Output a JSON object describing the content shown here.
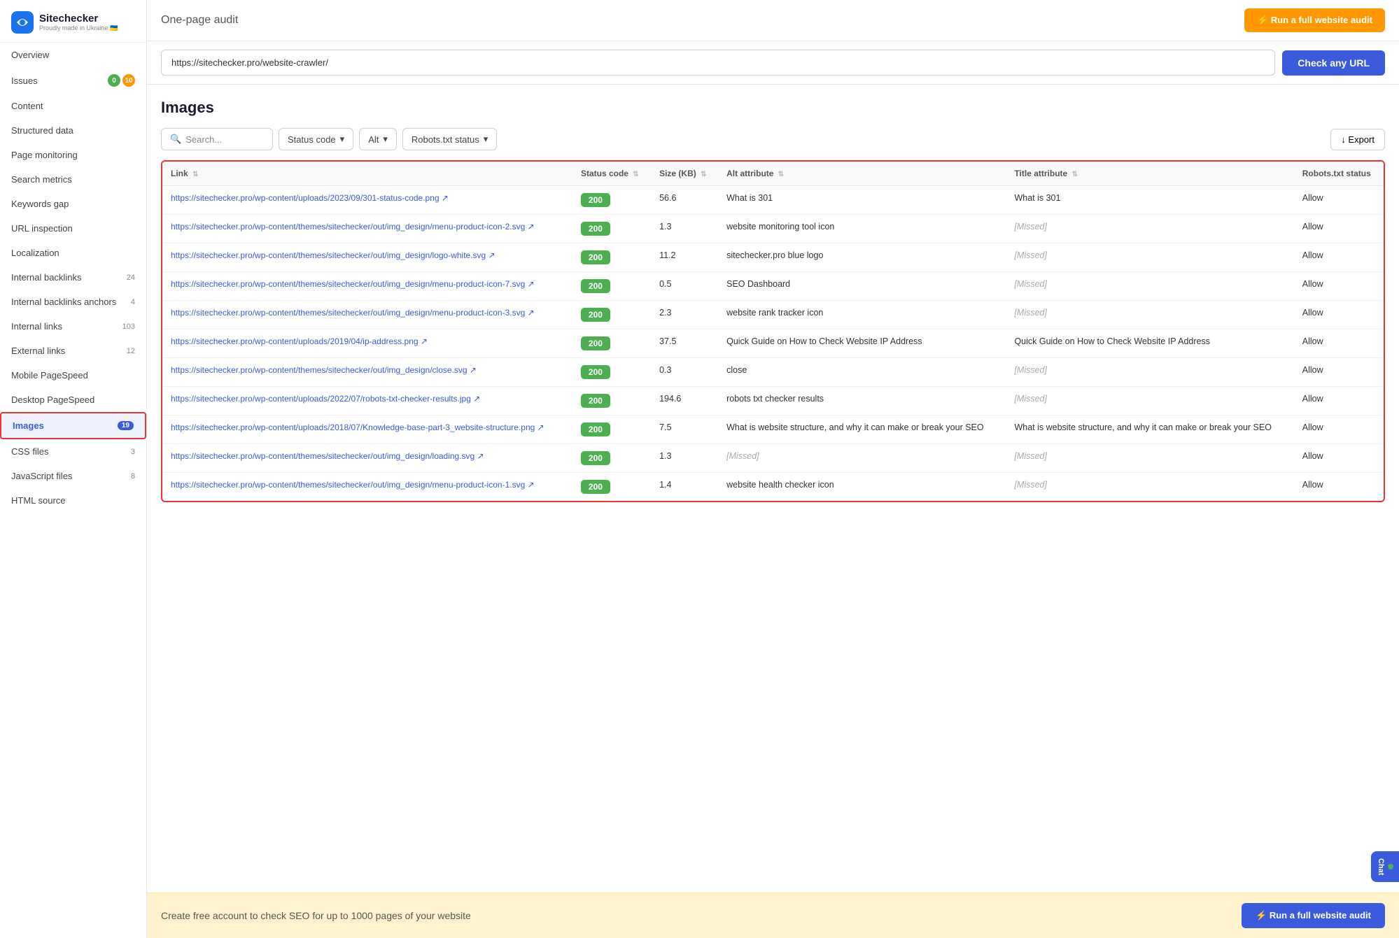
{
  "app": {
    "logo_text": "Sitechecker",
    "logo_sub": "Proudly made in Ukraine 🇺🇦"
  },
  "header": {
    "page_title": "One-page audit",
    "run_audit_top_label": "⚡ Run a full website audit",
    "url_value": "https://sitechecker.pro/website-crawler/",
    "check_url_label": "Check any URL"
  },
  "sidebar": {
    "items": [
      {
        "label": "Overview",
        "count": null,
        "active": false
      },
      {
        "label": "Issues",
        "count": null,
        "badges": [
          "0",
          "10"
        ],
        "active": false
      },
      {
        "label": "Content",
        "count": null,
        "active": false
      },
      {
        "label": "Structured data",
        "count": null,
        "active": false
      },
      {
        "label": "Page monitoring",
        "count": null,
        "active": false
      },
      {
        "label": "Search metrics",
        "count": null,
        "active": false
      },
      {
        "label": "Keywords gap",
        "count": null,
        "active": false
      },
      {
        "label": "URL inspection",
        "count": null,
        "active": false
      },
      {
        "label": "Localization",
        "count": null,
        "active": false
      },
      {
        "label": "Internal backlinks",
        "count": "24",
        "active": false
      },
      {
        "label": "Internal backlinks anchors",
        "count": "4",
        "active": false
      },
      {
        "label": "Internal links",
        "count": "103",
        "active": false
      },
      {
        "label": "External links",
        "count": "12",
        "active": false
      },
      {
        "label": "Mobile PageSpeed",
        "count": null,
        "active": false
      },
      {
        "label": "Desktop PageSpeed",
        "count": null,
        "active": false
      },
      {
        "label": "Images",
        "count": "19",
        "active": true,
        "highlighted": true
      },
      {
        "label": "CSS files",
        "count": "3",
        "active": false
      },
      {
        "label": "JavaScript files",
        "count": "8",
        "active": false
      },
      {
        "label": "HTML source",
        "count": null,
        "active": false
      }
    ]
  },
  "images_section": {
    "title": "Images",
    "search_placeholder": "Search...",
    "filters": [
      {
        "label": "Status code",
        "has_dropdown": true
      },
      {
        "label": "Alt",
        "has_dropdown": true
      },
      {
        "label": "Robots.txt status",
        "has_dropdown": true
      }
    ],
    "export_label": "↓ Export",
    "columns": [
      {
        "label": "Link",
        "sortable": true
      },
      {
        "label": "Status code",
        "sortable": true
      },
      {
        "label": "Size (KB)",
        "sortable": true
      },
      {
        "label": "Alt attribute",
        "sortable": true
      },
      {
        "label": "Title attribute",
        "sortable": true
      },
      {
        "label": "Robots.txt status",
        "sortable": false
      }
    ],
    "rows": [
      {
        "link": "https://sitechecker.pro/wp-content/uploads/2023/09/301-status-code.png ↗",
        "link_href": "https://sitechecker.pro/wp-content/uploads/2023/09/301-status-code.png",
        "status_code": "200",
        "size": "56.6",
        "alt": "What is 301",
        "title": "What is 301",
        "robots": "Allow"
      },
      {
        "link": "https://sitechecker.pro/wp-content/themes/sitechecker/out/img_design/menu-product-icon-2.svg ↗",
        "link_href": "https://sitechecker.pro/wp-content/themes/sitechecker/out/img_design/menu-product-icon-2.svg",
        "status_code": "200",
        "size": "1.3",
        "alt": "website monitoring tool icon",
        "title": "[Missed]",
        "title_missed": true,
        "robots": "Allow"
      },
      {
        "link": "https://sitechecker.pro/wp-content/themes/sitechecker/out/img_design/logo-white.svg ↗",
        "link_href": "https://sitechecker.pro/wp-content/themes/sitechecker/out/img_design/logo-white.svg",
        "status_code": "200",
        "size": "11.2",
        "alt": "sitechecker.pro blue logo",
        "title": "[Missed]",
        "title_missed": true,
        "robots": "Allow"
      },
      {
        "link": "https://sitechecker.pro/wp-content/themes/sitechecker/out/img_design/menu-product-icon-7.svg ↗",
        "link_href": "https://sitechecker.pro/wp-content/themes/sitechecker/out/img_design/menu-product-icon-7.svg",
        "status_code": "200",
        "size": "0.5",
        "alt": "SEO Dashboard",
        "title": "[Missed]",
        "title_missed": true,
        "robots": "Allow"
      },
      {
        "link": "https://sitechecker.pro/wp-content/themes/sitechecker/out/img_design/menu-product-icon-3.svg ↗",
        "link_href": "https://sitechecker.pro/wp-content/themes/sitechecker/out/img_design/menu-product-icon-3.svg",
        "status_code": "200",
        "size": "2.3",
        "alt": "website rank tracker icon",
        "title": "[Missed]",
        "title_missed": true,
        "robots": "Allow"
      },
      {
        "link": "https://sitechecker.pro/wp-content/uploads/2019/04/ip-address.png ↗",
        "link_href": "https://sitechecker.pro/wp-content/uploads/2019/04/ip-address.png",
        "status_code": "200",
        "size": "37.5",
        "alt": "Quick Guide on How to Check Website IP Address",
        "title": "Quick Guide on How to Check Website IP Address",
        "robots": "Allow"
      },
      {
        "link": "https://sitechecker.pro/wp-content/themes/sitechecker/out/img_design/close.svg ↗",
        "link_href": "https://sitechecker.pro/wp-content/themes/sitechecker/out/img_design/close.svg",
        "status_code": "200",
        "size": "0.3",
        "alt": "close",
        "title": "[Missed]",
        "title_missed": true,
        "robots": "Allow"
      },
      {
        "link": "https://sitechecker.pro/wp-content/uploads/2022/07/robots-txt-checker-results.jpg ↗",
        "link_href": "https://sitechecker.pro/wp-content/uploads/2022/07/robots-txt-checker-results.jpg",
        "status_code": "200",
        "size": "194.6",
        "alt": "robots txt checker results",
        "title": "[Missed]",
        "title_missed": true,
        "robots": "Allow"
      },
      {
        "link": "https://sitechecker.pro/wp-content/uploads/2018/07/Knowledge-base-part-3_website-structure.png ↗",
        "link_href": "https://sitechecker.pro/wp-content/uploads/2018/07/Knowledge-base-part-3_website-structure.png",
        "status_code": "200",
        "size": "7.5",
        "alt": "What is website structure, and why it can make or break your SEO",
        "title": "What is website structure, and why it can make or break your SEO",
        "robots": "Allow"
      },
      {
        "link": "https://sitechecker.pro/wp-content/themes/sitechecker/out/img_design/loading.svg ↗",
        "link_href": "https://sitechecker.pro/wp-content/themes/sitechecker/out/img_design/loading.svg",
        "status_code": "200",
        "size": "1.3",
        "alt": "[Missed]",
        "alt_missed": true,
        "title": "[Missed]",
        "title_missed": true,
        "robots": "Allow"
      },
      {
        "link": "https://sitechecker.pro/wp-content/themes/sitechecker/out/img_design/menu-product-icon-1.svg ↗",
        "link_href": "https://sitechecker.pro/wp-content/themes/sitechecker/out/img_design/menu-product-icon-1.svg",
        "status_code": "200",
        "size": "1.4",
        "alt": "website health checker icon",
        "title": "[Missed]",
        "title_missed": true,
        "robots": "Allow"
      }
    ]
  },
  "bottom_banner": {
    "text": "Create free account to check SEO for up to 1000 pages of your website",
    "btn_label": "⚡ Run a full website audit"
  },
  "chat": {
    "label": "Chat"
  }
}
